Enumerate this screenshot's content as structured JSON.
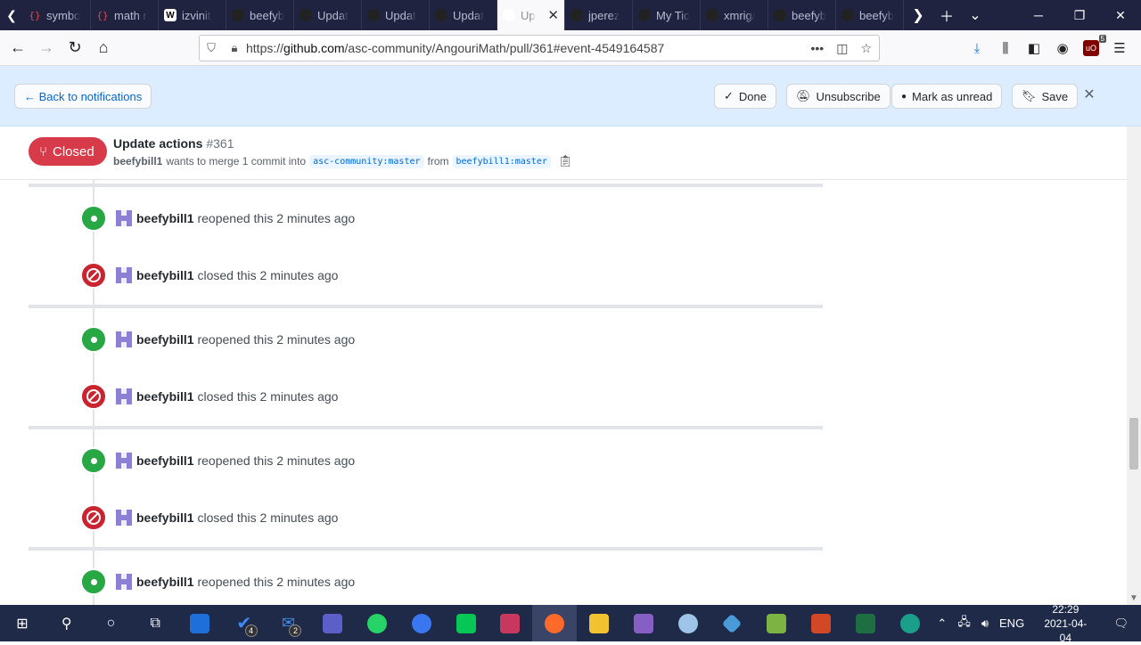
{
  "browser": {
    "tabs": [
      {
        "title": "symbo",
        "fav": "brace"
      },
      {
        "title": "math r",
        "fav": "brace"
      },
      {
        "title": "izvinit",
        "fav": "w"
      },
      {
        "title": "beefyb",
        "fav": "gh"
      },
      {
        "title": "Updat",
        "fav": "gh"
      },
      {
        "title": "Updat",
        "fav": "gh"
      },
      {
        "title": "Updat",
        "fav": "gh"
      },
      {
        "title": "Up",
        "fav": "ghw",
        "active": true
      },
      {
        "title": "jperez",
        "fav": "gh"
      },
      {
        "title": "My Tic",
        "fav": "gh"
      },
      {
        "title": "xmrig/",
        "fav": "gh"
      },
      {
        "title": "beefyb",
        "fav": "gh"
      },
      {
        "title": "beefyb",
        "fav": "gh"
      }
    ],
    "url_prefix": "https://",
    "url_domain": "github.com",
    "url_path": "/asc-community/AngouriMath/pull/361#event-4549164587",
    "ublock_count": "5"
  },
  "notification": {
    "back_label": "← Back to notifications",
    "done_label": "Done",
    "unsubscribe_label": "Unsubscribe",
    "mark_unread_label": "Mark as unread",
    "save_label": "Save"
  },
  "pr": {
    "state": "Closed",
    "title": "Update actions",
    "number": "#361",
    "author": "beefybill1",
    "merge_text": "wants to merge 1 commit into",
    "base_branch": "asc-community:master",
    "from_text": "from",
    "head_branch": "beefybill1:master"
  },
  "timeline": {
    "events": [
      {
        "type": "reopened",
        "user": "beefybill1",
        "text": "reopened this 2 minutes ago"
      },
      {
        "type": "closed",
        "user": "beefybill1",
        "text": "closed this 2 minutes ago"
      },
      {
        "type": "reopened",
        "user": "beefybill1",
        "text": "reopened this 2 minutes ago"
      },
      {
        "type": "closed",
        "user": "beefybill1",
        "text": "closed this 2 minutes ago"
      },
      {
        "type": "reopened",
        "user": "beefybill1",
        "text": "reopened this 2 minutes ago"
      },
      {
        "type": "closed",
        "user": "beefybill1",
        "text": "closed this 2 minutes ago"
      },
      {
        "type": "reopened",
        "user": "beefybill1",
        "text": "reopened this 2 minutes ago"
      }
    ]
  },
  "taskbar": {
    "todo_count": "4",
    "mail_count": "2",
    "language": "ENG",
    "time": "22:29",
    "date": "2021-04-04"
  },
  "colors": {
    "open": "#28a745",
    "closed": "#cb2431",
    "notif_bg": "#dbedff"
  }
}
